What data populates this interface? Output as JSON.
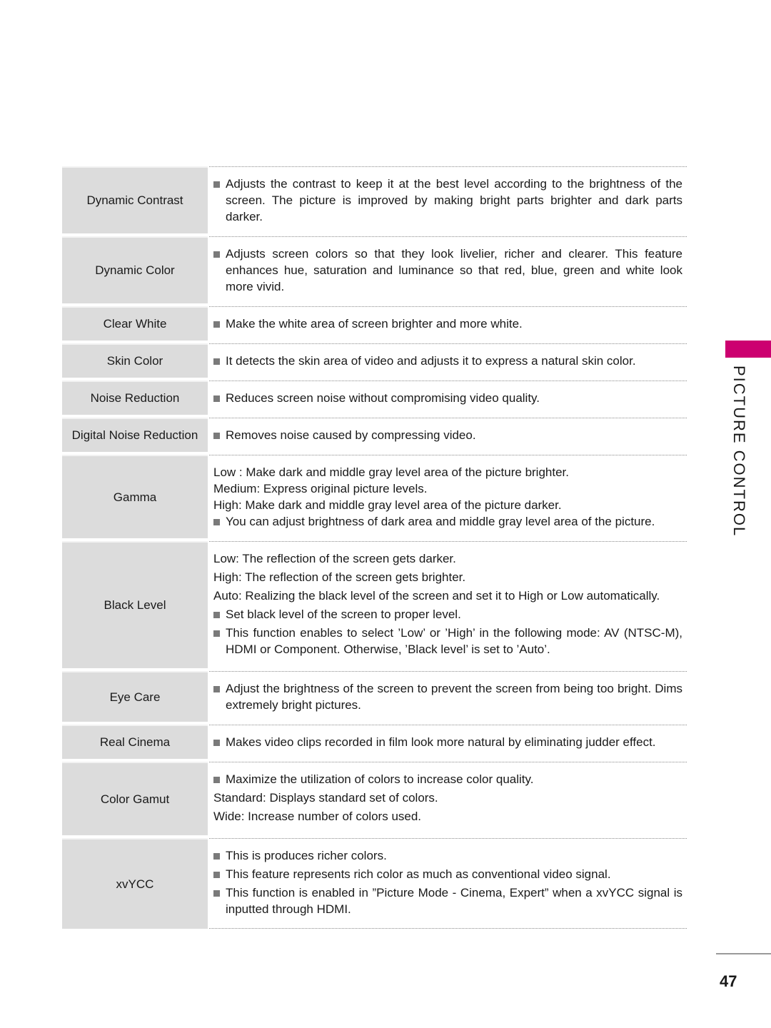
{
  "section_title": "PICTURE CONTROL",
  "page_number": "47",
  "accent_color": "#cc0070",
  "rows": [
    {
      "label": "Dynamic Contrast",
      "lines": [
        {
          "bullet": true,
          "text": "Adjusts the contrast to keep it at the best level according to the brightness of the screen. The picture is improved by making bright parts brighter and dark parts darker."
        }
      ]
    },
    {
      "label": "Dynamic Color",
      "lines": [
        {
          "bullet": true,
          "text": "Adjusts screen colors so that they look livelier, richer and clearer. This feature enhances hue, saturation and luminance so that red, blue, green and white look more vivid."
        }
      ]
    },
    {
      "label": "Clear White",
      "lines": [
        {
          "bullet": true,
          "text": "Make the white area of screen brighter and more white."
        }
      ]
    },
    {
      "label": "Skin Color",
      "lines": [
        {
          "bullet": true,
          "text": "It detects the skin area of video and adjusts it to express a natural skin color."
        }
      ]
    },
    {
      "label": "Noise Reduction",
      "lines": [
        {
          "bullet": true,
          "text": "Reduces screen noise without compromising video quality."
        }
      ]
    },
    {
      "label": "Digital Noise Reduction",
      "lines": [
        {
          "bullet": true,
          "text": "Removes noise caused by compressing video."
        }
      ]
    },
    {
      "label": "Gamma",
      "lines": [
        {
          "bullet": false,
          "text": "Low : Make dark and middle gray level area of the picture brighter."
        },
        {
          "bullet": false,
          "text": "Medium: Express original picture levels."
        },
        {
          "bullet": false,
          "text": "High: Make dark and middle gray level area of the picture darker."
        },
        {
          "bullet": true,
          "text": "You can adjust brightness of dark area and middle gray level area of the picture."
        }
      ]
    },
    {
      "label": "Black Level",
      "lines": [
        {
          "bullet": false,
          "text": "Low: The reflection of the screen gets darker."
        },
        {
          "bullet": false,
          "text": "High: The reflection of the screen gets brighter."
        },
        {
          "bullet": false,
          "text": "Auto: Realizing the black level of the screen and set it to High or Low automatically."
        },
        {
          "bullet": true,
          "text": "Set black level of the screen to proper level."
        },
        {
          "bullet": true,
          "text": "This function enables to select ’Low’ or ’High’ in the following mode: AV (NTSC-M), HDMI or Component. Otherwise, ’Black level’ is set to ’Auto’."
        }
      ]
    },
    {
      "label": "Eye Care",
      "lines": [
        {
          "bullet": true,
          "text": "Adjust the brightness of the screen to prevent the screen from being too bright. Dims extremely bright pictures."
        }
      ]
    },
    {
      "label": "Real Cinema",
      "lines": [
        {
          "bullet": true,
          "text": "Makes video clips recorded in film look more natural by eliminating judder effect."
        }
      ]
    },
    {
      "label": "Color Gamut",
      "lines": [
        {
          "bullet": true,
          "text": "Maximize the utilization of colors to increase color quality."
        },
        {
          "bullet": false,
          "text": "Standard: Displays standard set of colors."
        },
        {
          "bullet": false,
          "text": "Wide: Increase number of colors used."
        }
      ]
    },
    {
      "label": "xvYCC",
      "lines": [
        {
          "bullet": true,
          "text": "This is produces richer colors."
        },
        {
          "bullet": true,
          "text": "This feature represents rich color as much as conventional video signal."
        },
        {
          "bullet": true,
          "text": "This function is enabled in ”Picture Mode - Cinema, Expert” when a xvYCC signal is inputted through HDMI."
        }
      ]
    }
  ]
}
